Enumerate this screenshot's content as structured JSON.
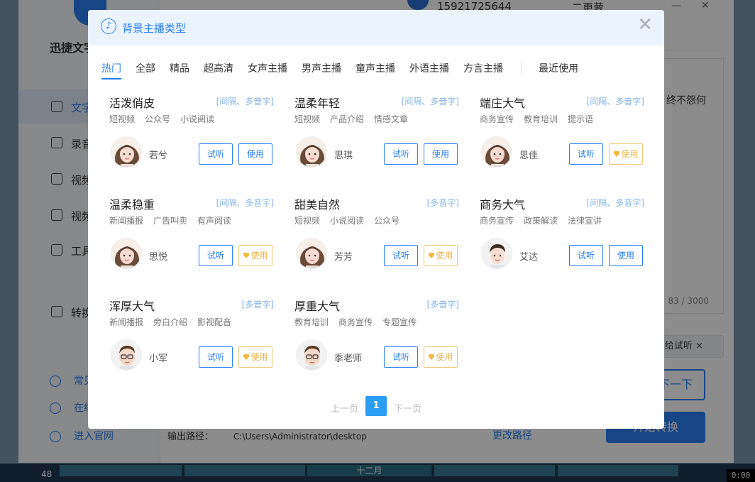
{
  "colors": {
    "accent": "#2a7ff3",
    "vip": "#f3b93c",
    "header_bg": "#eaf3fe"
  },
  "app": {
    "brand": "迅捷文字",
    "phone": "15921725644",
    "username": "二更萝",
    "nav": [
      {
        "label": "文字",
        "icon": "text-icon"
      },
      {
        "label": "录音",
        "icon": "record-icon"
      },
      {
        "label": "视频",
        "icon": "video-icon"
      },
      {
        "label": "视频",
        "icon": "video-icon"
      },
      {
        "label": "工具",
        "icon": "toolbox-icon"
      },
      {
        "label": "转换",
        "icon": "convert-icon"
      }
    ],
    "bottom_links": [
      "常见",
      "在线",
      "进入官网"
    ],
    "text_snippet": "终不怨何",
    "char_count": "83 / 3000",
    "chip_label": "给试听 ×",
    "next_label": "下一下",
    "start_label": "开始转换",
    "output_label": "输出路径：",
    "output_path": "C:\\Users\\Administrator\\desktop",
    "change_path": "更改路径"
  },
  "taskbar": {
    "left_number": "48",
    "month": "十二月",
    "clock": "0:00"
  },
  "modal": {
    "title": "背景主播类型",
    "tabs": [
      "热门",
      "全部",
      "精品",
      "超高清",
      "女声主播",
      "男声主播",
      "童声主播",
      "外语主播",
      "方言主播",
      "最近使用"
    ],
    "listen_label": "试听",
    "use_label": "使用",
    "cards": [
      {
        "title": "活泼俏皮",
        "tag": "[间隔、多音字]",
        "cats": [
          "短视频",
          "公众号",
          "小说阅读"
        ],
        "anchor": "若兮",
        "vip": false,
        "avatar": "female"
      },
      {
        "title": "温柔年轻",
        "tag": "[间隔、多音字]",
        "cats": [
          "短视频",
          "产品介绍",
          "情感文章"
        ],
        "anchor": "思琪",
        "vip": false,
        "avatar": "female"
      },
      {
        "title": "端庄大气",
        "tag": "[间隔、多音字]",
        "cats": [
          "商务宣传",
          "教育培训",
          "提示语"
        ],
        "anchor": "思佳",
        "vip": true,
        "avatar": "female"
      },
      {
        "title": "温柔稳重",
        "tag": "[间隔、多音字]",
        "cats": [
          "新闻播报",
          "广告叫卖",
          "有声阅读"
        ],
        "anchor": "思悦",
        "vip": true,
        "avatar": "female"
      },
      {
        "title": "甜美自然",
        "tag": "[多音字]",
        "cats": [
          "短视频",
          "小说阅读",
          "公众号"
        ],
        "anchor": "芳芳",
        "vip": true,
        "avatar": "female"
      },
      {
        "title": "商务大气",
        "tag": "[间隔、多音字]",
        "cats": [
          "商务宣传",
          "政策解读",
          "法律宣讲"
        ],
        "anchor": "艾达",
        "vip": false,
        "avatar": "male"
      },
      {
        "title": "浑厚大气",
        "tag": "[多音字]",
        "cats": [
          "新闻播报",
          "旁白介绍",
          "影视配音"
        ],
        "anchor": "小军",
        "vip": true,
        "avatar": "male-glasses"
      },
      {
        "title": "厚重大气",
        "tag": "[多音字]",
        "cats": [
          "教育培训",
          "商务宣传",
          "专题宣传"
        ],
        "anchor": "季老师",
        "vip": true,
        "avatar": "male-glasses"
      }
    ],
    "pager": {
      "prev": "上一页",
      "current": "1",
      "next": "下一页"
    }
  }
}
